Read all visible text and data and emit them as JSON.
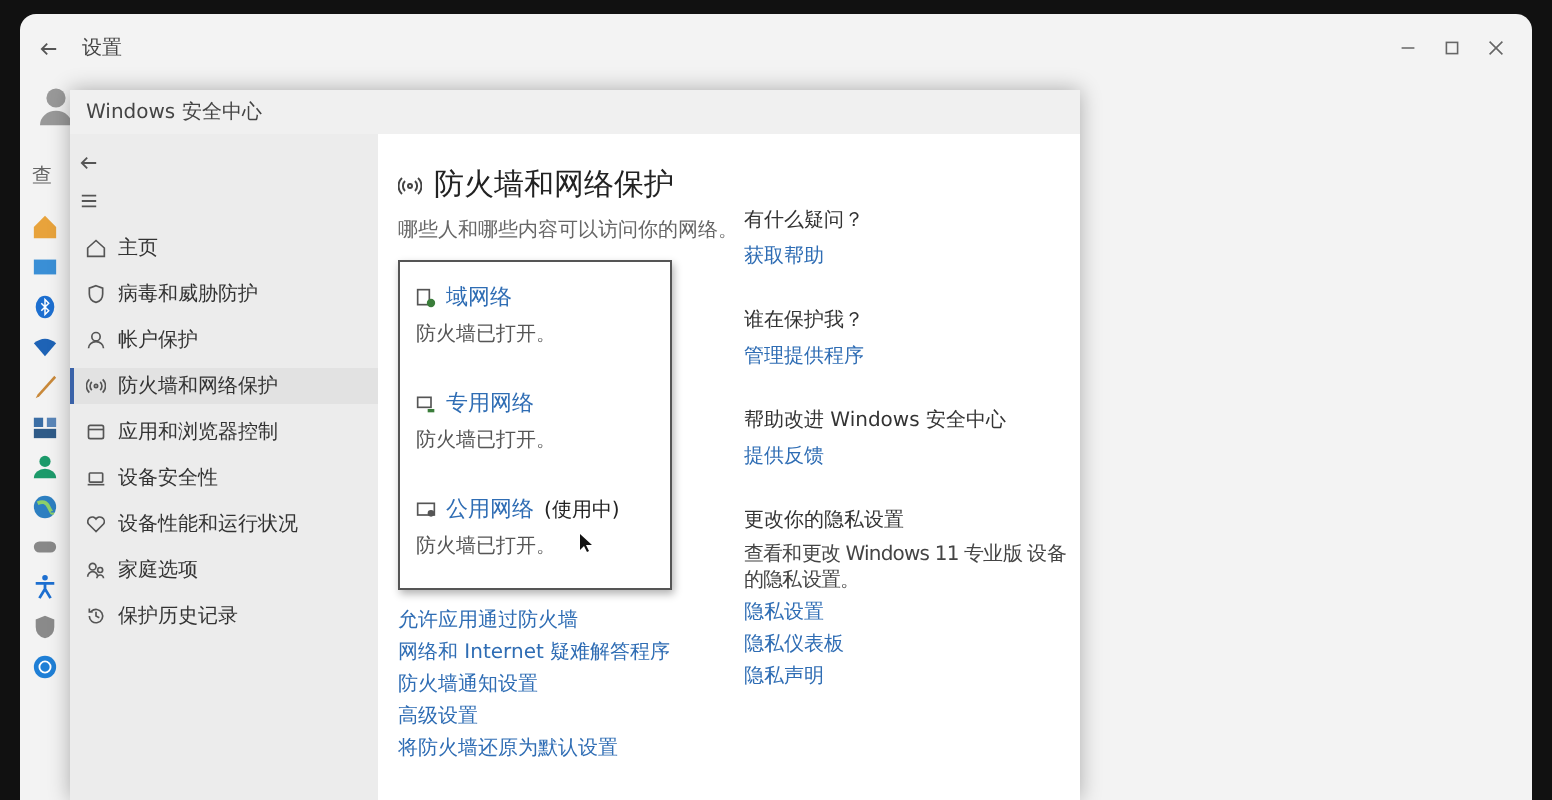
{
  "settings_window": {
    "title": "设置",
    "search_placeholder": "查"
  },
  "security_window": {
    "title": "Windows 安全中心",
    "nav": [
      {
        "label": "主页",
        "kind": "home",
        "selected": false
      },
      {
        "label": "病毒和威胁防护",
        "kind": "shield",
        "selected": false
      },
      {
        "label": "帐户保护",
        "kind": "person",
        "selected": false
      },
      {
        "label": "防火墙和网络保护",
        "kind": "antenna",
        "selected": true
      },
      {
        "label": "应用和浏览器控制",
        "kind": "window",
        "selected": false
      },
      {
        "label": "设备安全性",
        "kind": "laptop",
        "selected": false
      },
      {
        "label": "设备性能和运行状况",
        "kind": "heart",
        "selected": false
      },
      {
        "label": "家庭选项",
        "kind": "family",
        "selected": false
      },
      {
        "label": "保护历史记录",
        "kind": "history",
        "selected": false
      }
    ],
    "page": {
      "title": "防火墙和网络保护",
      "subtitle": "哪些人和哪些内容可以访问你的网络。",
      "networks": [
        {
          "name": "域网络",
          "kind": "domain",
          "status": "防火墙已打开。"
        },
        {
          "name": "专用网络",
          "kind": "private",
          "status": "防火墙已打开。"
        },
        {
          "name": "公用网络",
          "kind": "public",
          "suffix": "(使用中)",
          "status": "防火墙已打开。"
        }
      ],
      "links": [
        "允许应用通过防火墙",
        "网络和 Internet 疑难解答程序",
        "防火墙通知设置",
        "高级设置",
        "将防火墙还原为默认设置"
      ],
      "side": [
        {
          "heading": "有什么疑问？",
          "links": [
            "获取帮助"
          ]
        },
        {
          "heading": "谁在保护我？",
          "links": [
            "管理提供程序"
          ]
        },
        {
          "heading": "帮助改进 Windows 安全中心",
          "links": [
            "提供反馈"
          ]
        },
        {
          "heading": "更改你的隐私设置",
          "text": "查看和更改 Windows 11 专业版 设备的隐私设置。",
          "links": [
            "隐私设置",
            "隐私仪表板",
            "隐私声明"
          ]
        }
      ]
    }
  }
}
